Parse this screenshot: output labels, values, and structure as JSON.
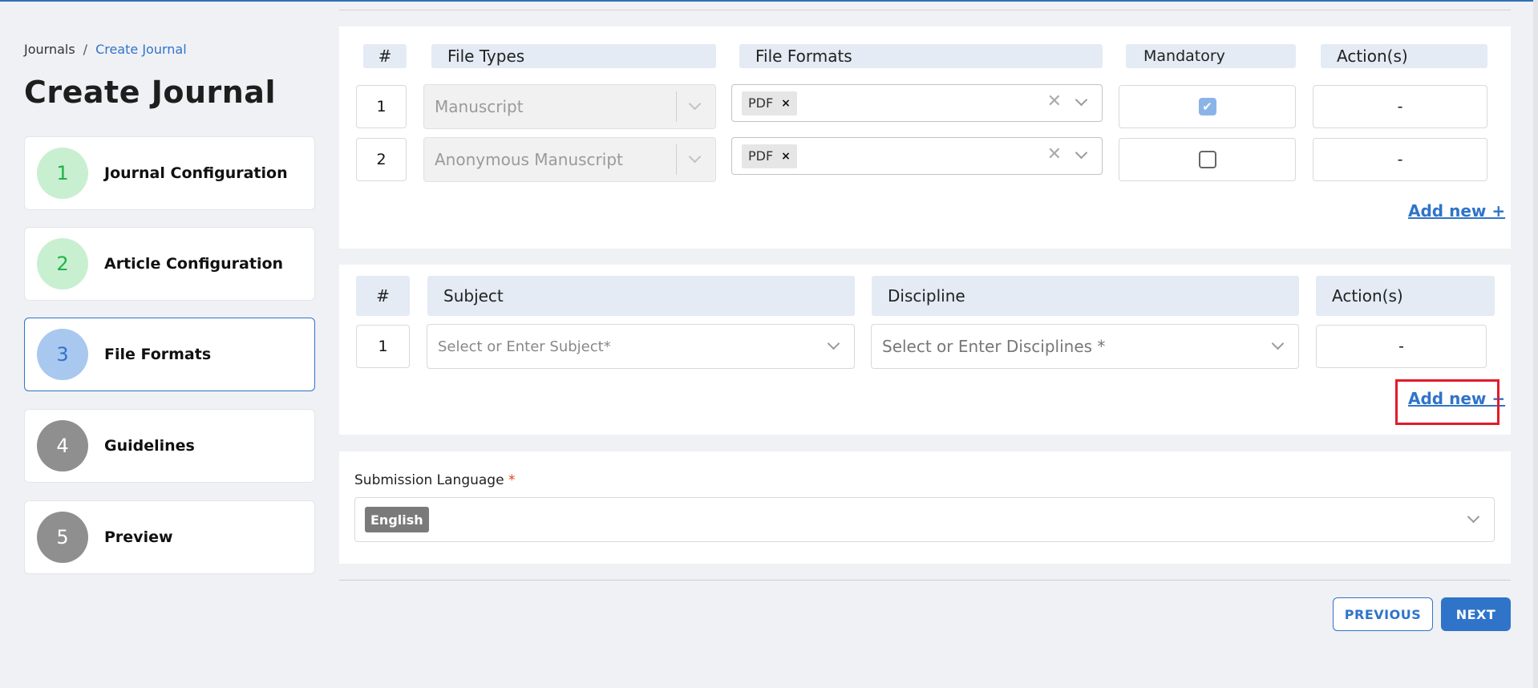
{
  "breadcrumb": {
    "root": "Journals",
    "separator": "/",
    "current": "Create Journal"
  },
  "page_title": "Create Journal",
  "steps": [
    {
      "number": "1",
      "label": "Journal Configuration",
      "state": "done"
    },
    {
      "number": "2",
      "label": "Article Configuration",
      "state": "done"
    },
    {
      "number": "3",
      "label": "File Formats",
      "state": "active"
    },
    {
      "number": "4",
      "label": "Guidelines",
      "state": "pending"
    },
    {
      "number": "5",
      "label": "Preview",
      "state": "pending"
    }
  ],
  "file_table": {
    "headers": {
      "num": "#",
      "file_types": "File Types",
      "file_formats": "File Formats",
      "mandatory": "Mandatory",
      "actions": "Action(s)"
    },
    "rows": [
      {
        "num": "1",
        "file_type": "Manuscript",
        "format_tag": "PDF",
        "tag_remove": "×",
        "clear": "✕",
        "mandatory": true,
        "action": "-"
      },
      {
        "num": "2",
        "file_type": "Anonymous Manuscript",
        "format_tag": "PDF",
        "tag_remove": "×",
        "clear": "✕",
        "mandatory": false,
        "action": "-"
      }
    ],
    "add_new": "Add new +"
  },
  "subject_table": {
    "headers": {
      "num": "#",
      "subject": "Subject",
      "discipline": "Discipline",
      "actions": "Action(s)"
    },
    "rows": [
      {
        "num": "1",
        "subject_placeholder": "Select or Enter Subject*",
        "discipline_placeholder": "Select or Enter Disciplines *",
        "action": "-"
      }
    ],
    "add_new": "Add new +"
  },
  "submission_language": {
    "label": "Submission Language",
    "required_mark": "*",
    "value": "English"
  },
  "buttons": {
    "previous": "PREVIOUS",
    "next": "NEXT"
  },
  "colors": {
    "accent": "#2f74c9",
    "done_step": "#c9efd1",
    "active_step": "#a9c8ef",
    "pending_step": "#8f8f8f",
    "highlight": "#e21b2a"
  }
}
